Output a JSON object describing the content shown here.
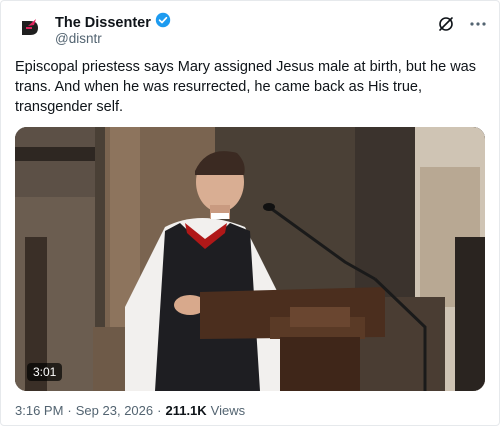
{
  "author": {
    "display_name": "The Dissenter",
    "handle": "@disntr",
    "verified_badge": "verified-badge-icon"
  },
  "icons": {
    "grok": "grok-icon",
    "more": "more-icon"
  },
  "tweet": {
    "text": "Episcopal priestess says Mary assigned Jesus male at birth, but he was trans. And when he was resurrected, he came back as His true, transgender self."
  },
  "media": {
    "duration": "3:01"
  },
  "meta": {
    "time": "3:16 PM",
    "separator": "·",
    "date": "Sep 23, 2026",
    "views_count": "211.1K",
    "views_label": "Views"
  },
  "colors": {
    "accent_red": "#e0245e",
    "verified_blue": "#1d9bf0",
    "muted": "#536471"
  }
}
